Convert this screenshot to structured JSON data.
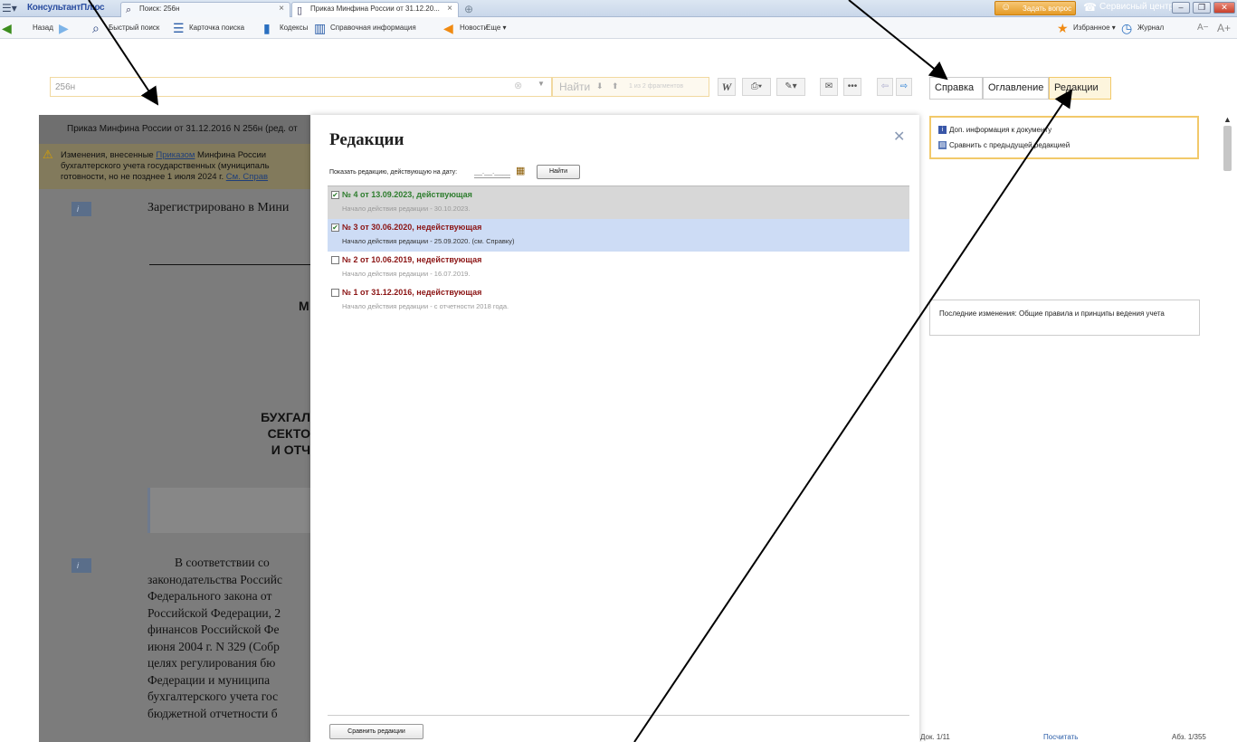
{
  "titlebar": {
    "app_name": "КонсультантПлюс",
    "tabs": [
      {
        "label": "Поиск: 256н",
        "icon": "search-icon"
      },
      {
        "label": "Приказ Минфина России от 31.12.20...",
        "icon": "document-icon"
      }
    ],
    "ask_question": "Задать вопрос",
    "service_center": "Сервисный центр"
  },
  "toolbar": {
    "back": "Назад",
    "quick_search": "Быстрый поиск",
    "search_card": "Карточка поиска",
    "codes": "Кодексы",
    "reference": "Справочная информация",
    "news": "Новости",
    "more": "Еще ▾",
    "favorites": "Избранное ▾",
    "journal": "Журнал",
    "font_minus": "A−",
    "font_plus": "A+"
  },
  "search": {
    "value": "256н",
    "find_label": "Найти",
    "fragments": "1 из 2 фрагментов"
  },
  "right_tabs": [
    "Справка",
    "Оглавление",
    "Редакции"
  ],
  "document": {
    "header": "Приказ Минфина России от 31.12.2016 N 256н (ред. от",
    "warning_line1": "Изменения, внесенные ",
    "warning_link": "Приказом",
    "warning_line1_rest": " Минфина России",
    "warning_line2": "бухгалтерского учета государственных (муниципаль",
    "warning_line3": "готовности, но не позднее 1 июля 2024 г. ",
    "warning_link2": "См. Справ",
    "registered": "Зарегистрировано в Мини",
    "ministry_letter": "М",
    "heading_lines": [
      "БУХГАЛ",
      "СЕКТО",
      "И ОТЧ"
    ],
    "body_lines": [
      "В соответствии со",
      "законодательства Российс",
      "Федерального закона от",
      "Российской Федерации, 2",
      "финансов Российской Фе",
      "июня 2004 г. N 329 (Собр",
      "целях регулирования бю",
      "Федерации и муниципа",
      "бухгалтерского учета гос",
      "бюджетной отчетности б"
    ]
  },
  "modal": {
    "title": "Редакции",
    "date_label": "Показать редакцию, действующую на дату:",
    "date_placeholder": "__.__.____",
    "find_button": "Найти",
    "revisions": [
      {
        "title": "№ 4 от 13.09.2023, действующая",
        "desc": "Начало действия редакции - 30.10.2023.",
        "checked": true
      },
      {
        "title": "№ 3 от 30.06.2020, недействующая",
        "desc": "Начало действия редакции - 25.09.2020. (см. Справку)",
        "checked": true
      },
      {
        "title": "№ 2 от 10.06.2019, недействующая",
        "desc": "Начало действия редакции - 16.07.2019.",
        "checked": false
      },
      {
        "title": "№ 1 от 31.12.2016, недействующая",
        "desc": "Начало действия редакции - с отчетности 2018 года.",
        "checked": false
      }
    ],
    "compare_button": "Сравнить редакции"
  },
  "right_panel": {
    "info_link": "Доп. информация к документу",
    "compare_link": "Сравнить с предыдущей редакцией",
    "last_changes": "Последние изменения: Общие правила и принципы ведения учета"
  },
  "status": {
    "doc": "Док. 1/11",
    "count": "Посчитать",
    "para": "Абз. 1/355"
  },
  "colors": {
    "accent_orange": "#f2c96a",
    "current_green": "#2e7d2e",
    "inactive_red": "#8b1414",
    "selected_blue": "#cddcf5"
  }
}
